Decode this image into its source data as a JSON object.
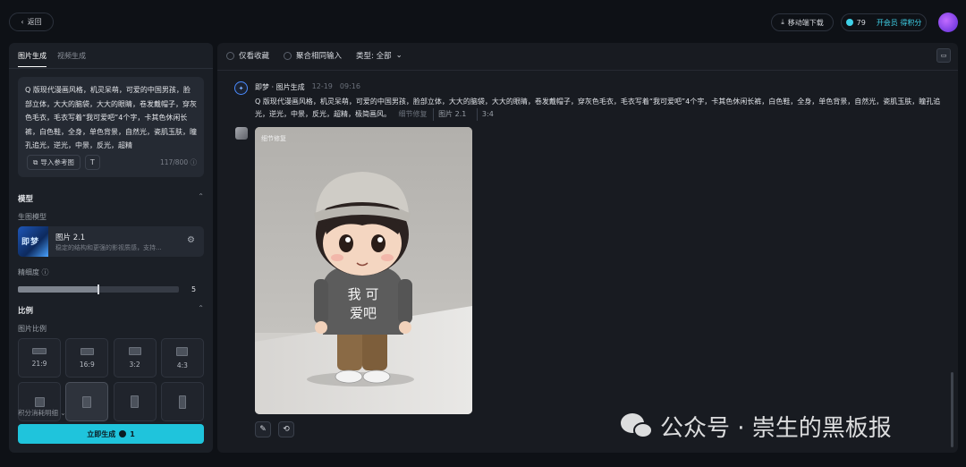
{
  "topbar": {
    "back_label": "返回",
    "download_label": "移动端下载",
    "points": "79",
    "vip_label": "开会员 得积分"
  },
  "left": {
    "tabs": [
      "图片生成",
      "视频生成"
    ],
    "prompt": "Q 版现代漫画风格，机灵呆萌，可爱的中国男孩，脸部立体，大大的脑袋，大大的眼睛，卷发戴帽子，穿灰色毛衣，毛衣写着“我可爱吧”4个字，卡其色休闲长裤，白色鞋，全身，单色背景，自然光，瓷肌玉肤，瞳孔追光，逆光，中景，反光，超精",
    "ref_label": "导入参考图",
    "counter": "117/800",
    "model_section": "模型",
    "gen_model_label": "生图模型",
    "model_thumb_text": "即梦",
    "model_name": "图片 2.1",
    "model_desc": "稳定的结构和更强的影视质感，支持...",
    "precision_label": "精细度",
    "precision_value": "5",
    "precision_fraction": 0.5,
    "ratio_section": "比例",
    "ratio_label": "图片比例",
    "ratios": [
      "21:9",
      "16:9",
      "3:2",
      "4:3"
    ],
    "cost_label": "积分消耗明细",
    "generate_label": "立即生成",
    "generate_cost": "1"
  },
  "main": {
    "filter_fav": "仅看收藏",
    "filter_merge": "聚合相同输入",
    "filter_type": "类型: 全部",
    "sender": "即梦 · 图片生成",
    "date": "12-19",
    "time": "09:16",
    "prompt": "Q 版现代漫画风格，机灵呆萌，可爱的中国男孩，脸部立体，大大的脑袋，大大的眼睛，卷发戴帽子，穿灰色毛衣，毛衣写着“我可爱吧”4个字，卡其色休闲长裤，白色鞋，全身，单色背景，自然光，瓷肌玉肤，瞳孔追光，逆光，中景，反光，超精，极简画风。",
    "detail_fix": "细节修复",
    "model_tag": "图片 2.1",
    "ratio_tag": "3:4",
    "image_tag": "细节修复",
    "shirt_line1": "我 可",
    "shirt_line2": "爱吧"
  },
  "watermark": "公众号 · 崇生的黑板报",
  "colors": {
    "accent": "#1fc4dc",
    "vip": "#3fd1e8",
    "panel": "#1b1f26",
    "background": "#0e1116"
  }
}
